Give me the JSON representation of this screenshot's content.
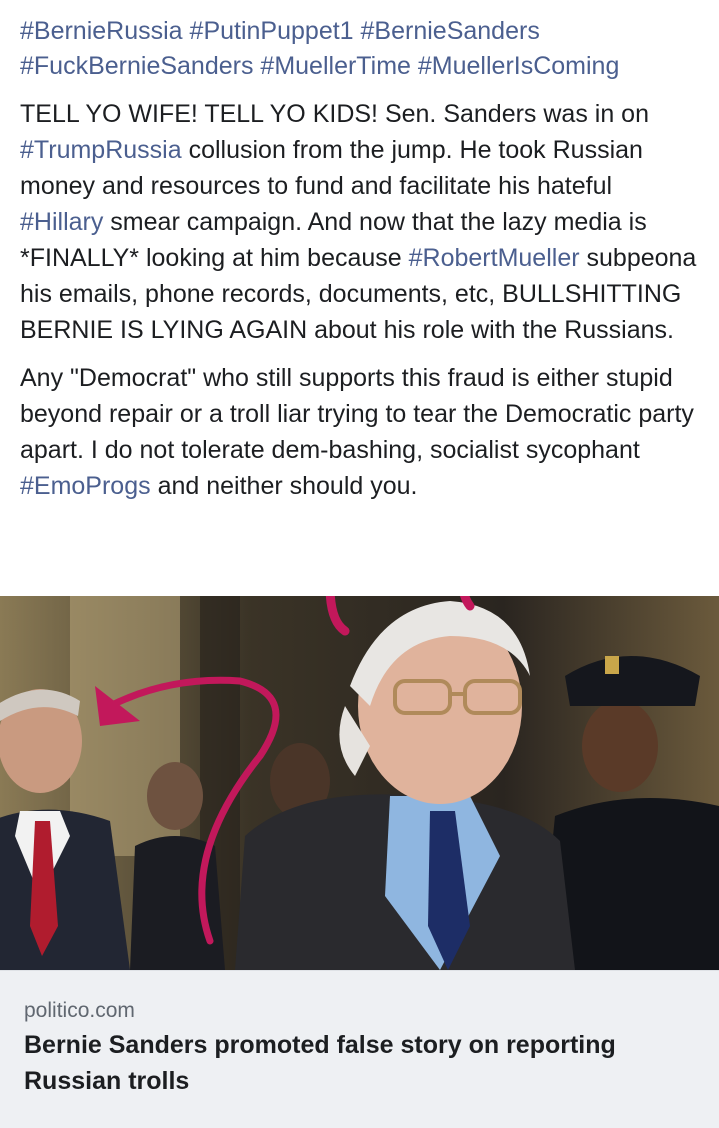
{
  "post": {
    "hashtags_line1": [
      "#BernieRussia",
      "#PutinPuppet1",
      "#BernieSanders"
    ],
    "hashtags_line2": [
      "#FuckBernieSanders",
      "#MuellerTime",
      "#MuellerIsComing"
    ],
    "paragraph1": {
      "t1": "TELL YO WIFE! TELL YO KIDS! Sen. Sanders was in on ",
      "tag1": "#TrumpRussia",
      "t2": " collusion from the jump. He took Russian money and resources to fund and facilitate his hateful ",
      "tag2": "#Hillary",
      "t3": " smear campaign. And now that the lazy media is *FINALLY* looking at him because ",
      "tag3": "#RobertMueller",
      "t4": " subpeona his emails, phone records, documents, etc, BULLSHITTING BERNIE IS LYING AGAIN about his role with the Russians."
    },
    "paragraph2": {
      "t1": "Any \"Democrat\" who still supports this fraud is either stupid beyond repair or a troll liar trying to tear the Democratic party apart. I do not tolerate dem-bashing, socialist sycophant ",
      "tag1": "#EmoProgs",
      "t2": " and neither should you."
    }
  },
  "link_preview": {
    "domain": "politico.com",
    "headline": "Bernie Sanders promoted false story on reporting Russian trolls"
  },
  "colors": {
    "hashtag": "#4b5f8f",
    "text": "#1c1e21",
    "card_bg": "#eef0f3",
    "annotation": "#c2185b"
  }
}
